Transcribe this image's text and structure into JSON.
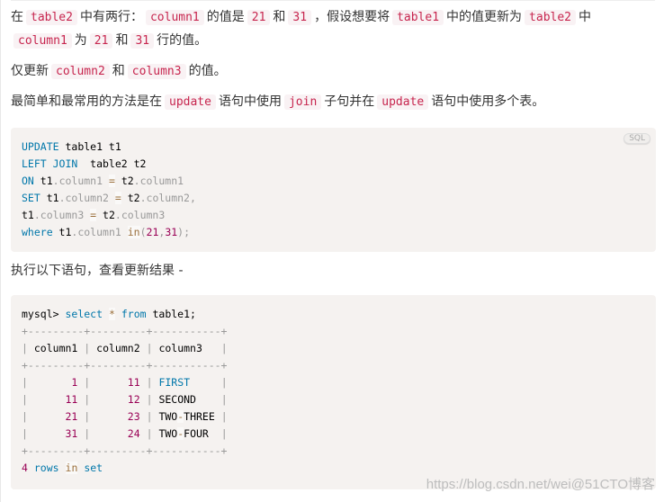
{
  "para1": {
    "t1": "在",
    "c1": "table2",
    "t2": "中有两行：",
    "c2": "column1",
    "t3": "的值是",
    "c3": "21",
    "t4": "和",
    "c4": "31",
    "t5": "，假设想要将",
    "c5": "table1",
    "t6": "中的值更新为",
    "c6": "table2",
    "t7": "中",
    "c7": "column1",
    "t8": "为",
    "c8": "21",
    "t9": "和",
    "c9": "31",
    "t10": "行的值。"
  },
  "para2": {
    "t1": "仅更新",
    "c1": "column2",
    "t2": "和",
    "c2": "column3",
    "t3": "的值。"
  },
  "para3": {
    "t1": "最简单和最常用的方法是在",
    "c1": "update",
    "t2": "语句中使用",
    "c2": "join",
    "t3": "子句并在",
    "c3": "update",
    "t4": "语句中使用多个表。"
  },
  "code1": {
    "language_badge": "SQL",
    "lines": [
      {
        "kw": "UPDATE",
        "rest": " table1 t1"
      },
      {
        "kw": "LEFT JOIN",
        "rest": "  table2 t2"
      },
      {
        "kw": "ON",
        "a": " t1",
        "b": ".column1 ",
        "op": "=",
        "c": " t2",
        "d": ".column1"
      },
      {
        "kw": "SET",
        "a": " t1",
        "b": ".column2 ",
        "op": "=",
        "c": " t2",
        "d": ".column2,"
      },
      {
        "a": "t1",
        "b": ".column3 ",
        "op": "=",
        "c": " t2",
        "d": ".column3"
      },
      {
        "kw": "where",
        "a": " t1",
        "b": ".column1 ",
        "fn": "in",
        "p1": "(",
        "n1": "21",
        "p2": ",",
        "n2": "31",
        "p3": ");"
      }
    ]
  },
  "para4": {
    "text": "执行以下语句，查看更新结果 -"
  },
  "code2": {
    "prompt": "mysql>",
    "kw_select": "select",
    "star": "*",
    "kw_from": "from",
    "table": " table1;",
    "border": "+---------+---------+-----------+",
    "headers": [
      "column1",
      "column2",
      "column3"
    ],
    "rows": [
      {
        "column1": "1",
        "column2": "11",
        "column3": "FIRST"
      },
      {
        "column1": "11",
        "column2": "12",
        "column3": "SECOND"
      },
      {
        "column1": "21",
        "column2": "23",
        "column3": "TWO-THREE"
      },
      {
        "column1": "31",
        "column2": "24",
        "column3": "TWO-FOUR"
      }
    ],
    "footer": {
      "count": "4",
      "rows": "rows",
      "in": "in",
      "set": "set"
    }
  },
  "watermark": {
    "url": "https://blog.csdn.net/wei",
    "brand": "@51CTO博客"
  }
}
